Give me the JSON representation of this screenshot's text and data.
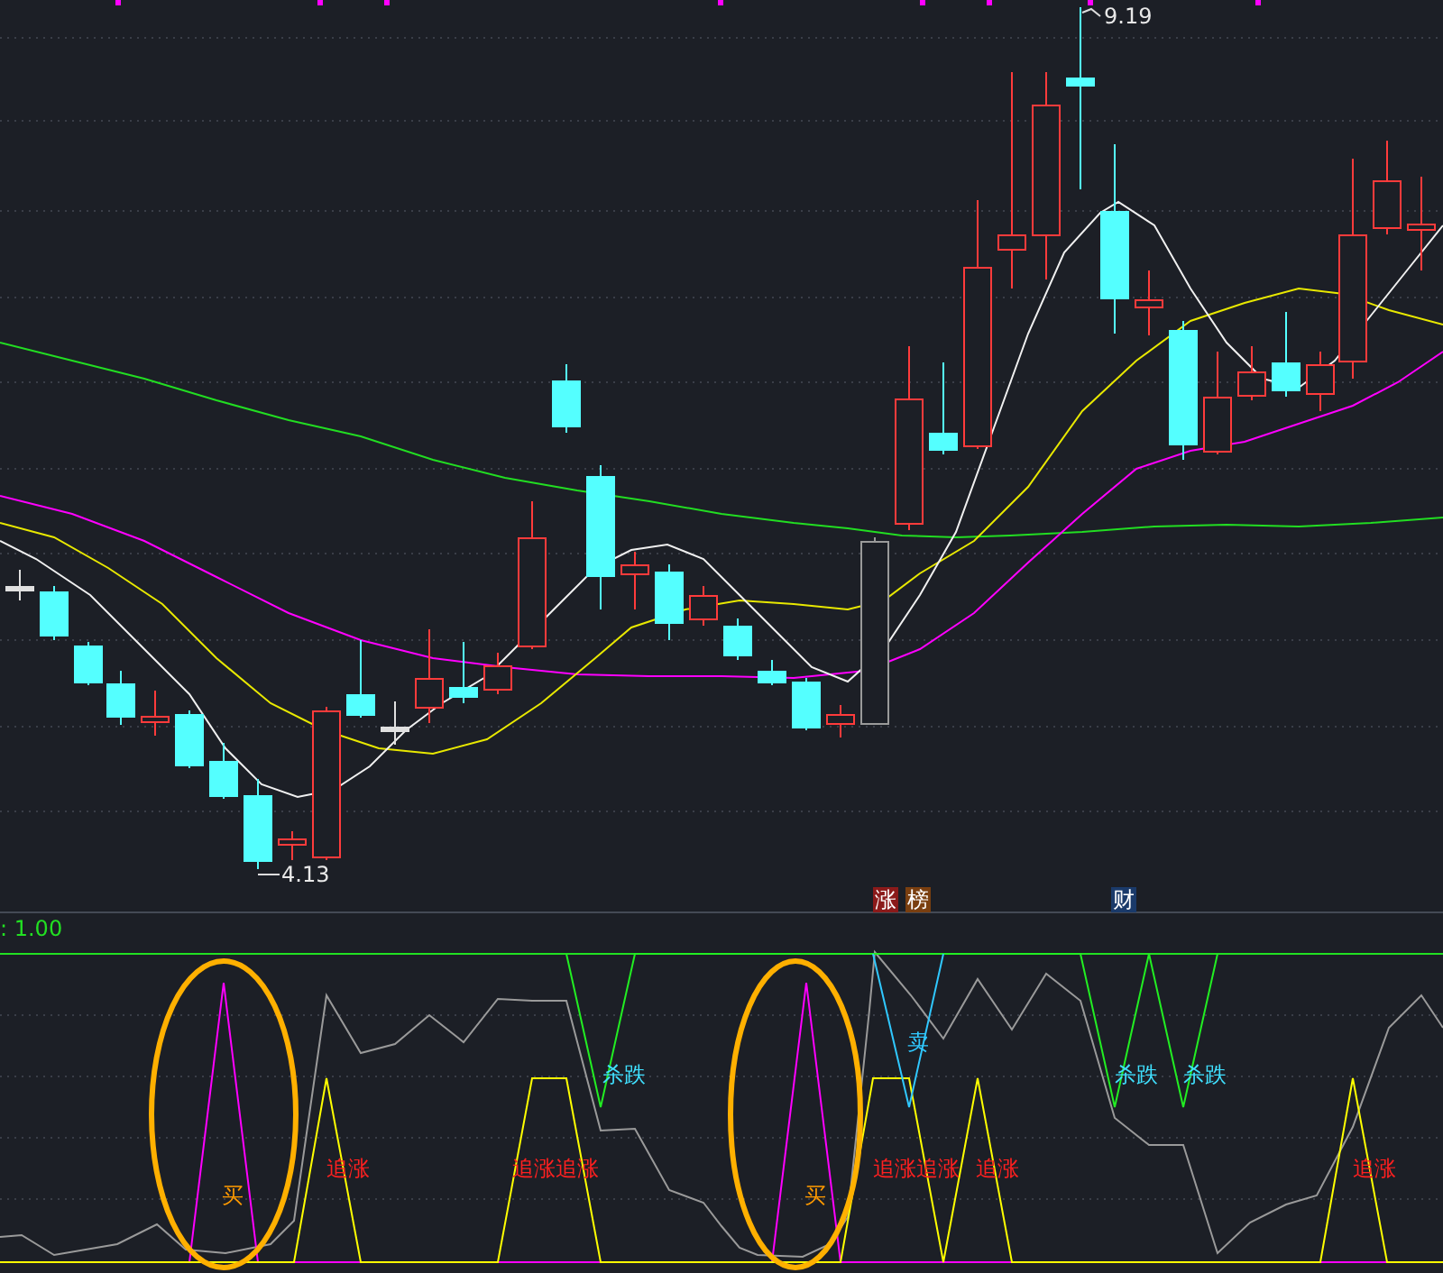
{
  "price_markers": [
    {
      "text": "9.19",
      "kind": "high"
    },
    {
      "text": "4.13",
      "kind": "low"
    }
  ],
  "event_badges": [
    {
      "text": "涨",
      "color": "#8b1a1a"
    },
    {
      "text": "榜",
      "color": "#7a3f10"
    },
    {
      "text": "财",
      "color": "#1a3a6a"
    }
  ],
  "indicator": {
    "legend": ": 1.00"
  },
  "signals": [
    {
      "text": "买",
      "kind": "buy"
    },
    {
      "text": "追涨",
      "kind": "chase"
    },
    {
      "text": "追涨",
      "kind": "chase"
    },
    {
      "text": "追涨",
      "kind": "chase"
    },
    {
      "text": "杀跌",
      "kind": "dump"
    },
    {
      "text": "买",
      "kind": "buy"
    },
    {
      "text": "追涨",
      "kind": "chase"
    },
    {
      "text": "追涨",
      "kind": "chase"
    },
    {
      "text": "卖",
      "kind": "sell"
    },
    {
      "text": "追涨",
      "kind": "chase"
    },
    {
      "text": "杀跌",
      "kind": "dump"
    },
    {
      "text": "杀跌",
      "kind": "dump"
    },
    {
      "text": "追涨",
      "kind": "chase"
    }
  ]
}
